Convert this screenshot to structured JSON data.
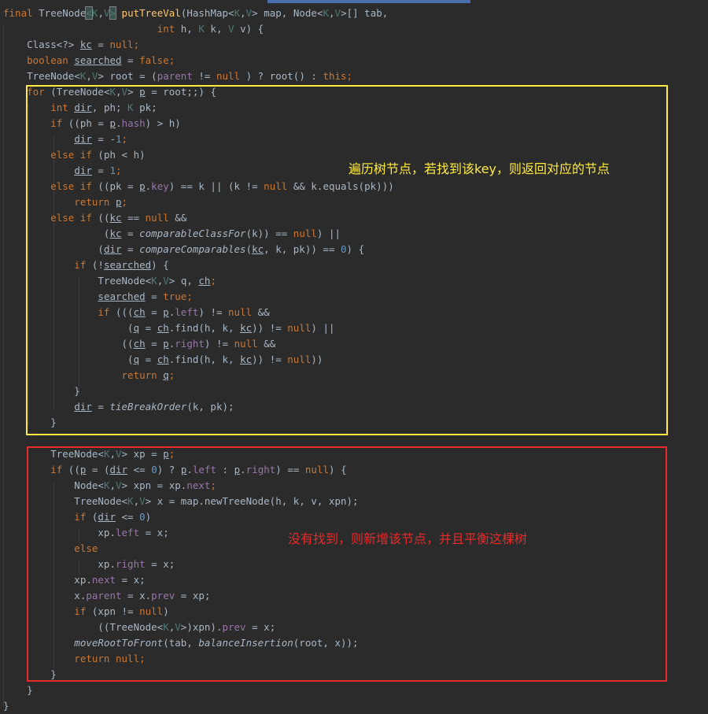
{
  "code_lines": [
    [
      [
        "kw",
        "final "
      ],
      [
        "",
        "TreeNode"
      ],
      [
        "tp brk",
        "<"
      ],
      [
        "tp",
        "K"
      ],
      [
        "",
        ","
      ],
      [
        "tp",
        "V"
      ],
      [
        "tp brk",
        ">"
      ],
      [
        "",
        ""
      ],
      [
        "fn",
        " putTreeVal"
      ],
      [
        "",
        "(HashMap<"
      ],
      [
        "tp",
        "K"
      ],
      [
        "",
        ","
      ],
      [
        "tp",
        "V"
      ],
      [
        "",
        "> map, Node<"
      ],
      [
        "tp",
        "K"
      ],
      [
        "",
        ","
      ],
      [
        "tp",
        "V"
      ],
      [
        "",
        ">[] tab,"
      ]
    ],
    [
      [
        "",
        "                          "
      ],
      [
        "kw",
        "int "
      ],
      [
        "",
        "h, "
      ],
      [
        "tp",
        "K "
      ],
      [
        "",
        "k, "
      ],
      [
        "tp",
        "V "
      ],
      [
        "",
        "v) {"
      ]
    ],
    [
      [
        "",
        "    Class<?> "
      ],
      [
        "ul",
        "kc"
      ],
      [
        "",
        " = "
      ],
      [
        "kw",
        "null"
      ],
      [
        "kw",
        ";"
      ]
    ],
    [
      [
        "kw",
        "    boolean "
      ],
      [
        "ul",
        "searched"
      ],
      [
        "",
        " = "
      ],
      [
        "kw",
        "false"
      ],
      [
        "kw",
        ";"
      ]
    ],
    [
      [
        "",
        "    TreeNode<"
      ],
      [
        "tp",
        "K"
      ],
      [
        "",
        ","
      ],
      [
        "tp",
        "V"
      ],
      [
        "",
        "> root = ("
      ],
      [
        "fld",
        "parent"
      ],
      [
        "",
        " != "
      ],
      [
        "kw",
        "null"
      ],
      [
        "",
        " ) ? root() : "
      ],
      [
        "kw",
        "this"
      ],
      [
        "kw",
        ";"
      ]
    ],
    [
      [
        "kw",
        "    for "
      ],
      [
        "",
        "(TreeNode<"
      ],
      [
        "tp",
        "K"
      ],
      [
        "",
        ","
      ],
      [
        "tp",
        "V"
      ],
      [
        "",
        "> "
      ],
      [
        "ul",
        "p"
      ],
      [
        "",
        " = root;;) {"
      ]
    ],
    [
      [
        "kw",
        "        int "
      ],
      [
        "ul",
        "dir"
      ],
      [
        "",
        ", ph; "
      ],
      [
        "tp",
        "K "
      ],
      [
        "",
        "pk;"
      ]
    ],
    [
      [
        "kw",
        "        if "
      ],
      [
        "",
        "(("
      ],
      [
        "",
        "ph = "
      ],
      [
        "ul",
        "p"
      ],
      [
        "",
        "."
      ],
      [
        "fld",
        "hash"
      ],
      [
        "",
        ") > h)"
      ]
    ],
    [
      [
        "",
        "            "
      ],
      [
        "ul",
        "dir"
      ],
      [
        "",
        " = -"
      ],
      [
        "num",
        "1"
      ],
      [
        "kw",
        ";"
      ]
    ],
    [
      [
        "kw",
        "        else if "
      ],
      [
        "",
        "(ph < h)"
      ]
    ],
    [
      [
        "",
        "            "
      ],
      [
        "ul",
        "dir"
      ],
      [
        "",
        " = "
      ],
      [
        "num",
        "1"
      ],
      [
        "kw",
        ";"
      ]
    ],
    [
      [
        "kw",
        "        else if "
      ],
      [
        "",
        "((pk = "
      ],
      [
        "ul",
        "p"
      ],
      [
        "",
        "."
      ],
      [
        "fld",
        "key"
      ],
      [
        "",
        ") == k || (k != "
      ],
      [
        "kw",
        "null "
      ],
      [
        "",
        "&& k.equals(pk)))"
      ]
    ],
    [
      [
        "kw",
        "            return "
      ],
      [
        "ul",
        "p"
      ],
      [
        "kw",
        ";"
      ]
    ],
    [
      [
        "kw",
        "        else if "
      ],
      [
        "",
        "(("
      ],
      [
        "ul",
        "kc"
      ],
      [
        "",
        " == "
      ],
      [
        "kw",
        "null "
      ],
      [
        "",
        "&&"
      ]
    ],
    [
      [
        "",
        "                 ("
      ],
      [
        "ul",
        "kc"
      ],
      [
        "",
        " = "
      ],
      [
        "it",
        "comparableClassFor"
      ],
      [
        "",
        "(k)) == "
      ],
      [
        "kw",
        "null"
      ],
      [
        "",
        ") ||"
      ]
    ],
    [
      [
        "",
        "                ("
      ],
      [
        "ul",
        "dir"
      ],
      [
        "",
        " = "
      ],
      [
        "it",
        "compareComparables"
      ],
      [
        "",
        "("
      ],
      [
        "ul",
        "kc"
      ],
      [
        "",
        ", k, pk)) == "
      ],
      [
        "num",
        "0"
      ],
      [
        "",
        ") {"
      ]
    ],
    [
      [
        "kw",
        "            if "
      ],
      [
        "",
        "(!"
      ],
      [
        "ul",
        "searched"
      ],
      [
        "",
        ") {"
      ]
    ],
    [
      [
        "",
        "                TreeNode<"
      ],
      [
        "tp",
        "K"
      ],
      [
        "",
        ","
      ],
      [
        "tp",
        "V"
      ],
      [
        "",
        "> "
      ],
      [
        "",
        "q, "
      ],
      [
        "ul",
        "ch"
      ],
      [
        "kw",
        ";"
      ]
    ],
    [
      [
        "",
        "                "
      ],
      [
        "ul",
        "searched"
      ],
      [
        "",
        " = "
      ],
      [
        "kw",
        "true"
      ],
      [
        "kw",
        ";"
      ]
    ],
    [
      [
        "kw",
        "                if "
      ],
      [
        "",
        "((("
      ],
      [
        "ul",
        "ch"
      ],
      [
        "",
        " = "
      ],
      [
        "ul",
        "p"
      ],
      [
        "",
        "."
      ],
      [
        "fld",
        "left"
      ],
      [
        "",
        ") != "
      ],
      [
        "kw",
        "null "
      ],
      [
        "",
        "&&"
      ]
    ],
    [
      [
        "",
        "                     ("
      ],
      [
        "ul",
        "q"
      ],
      [
        "",
        " = "
      ],
      [
        "ul",
        "ch"
      ],
      [
        "",
        ".find(h, k, "
      ],
      [
        "ul",
        "kc"
      ],
      [
        "",
        ")) != "
      ],
      [
        "kw",
        "null"
      ],
      [
        "",
        ") ||"
      ]
    ],
    [
      [
        "",
        "                    (("
      ],
      [
        "ul",
        "ch"
      ],
      [
        "",
        " = "
      ],
      [
        "ul",
        "p"
      ],
      [
        "",
        "."
      ],
      [
        "fld",
        "right"
      ],
      [
        "",
        ") != "
      ],
      [
        "kw",
        "null "
      ],
      [
        "",
        "&&"
      ]
    ],
    [
      [
        "",
        "                     ("
      ],
      [
        "ul",
        "q"
      ],
      [
        "",
        " = "
      ],
      [
        "ul",
        "ch"
      ],
      [
        "",
        ".find(h, k, "
      ],
      [
        "ul",
        "kc"
      ],
      [
        "",
        ")) != "
      ],
      [
        "kw",
        "null"
      ],
      [
        "",
        "))"
      ]
    ],
    [
      [
        "kw",
        "                    return "
      ],
      [
        "ul",
        "q"
      ],
      [
        "kw",
        ";"
      ]
    ],
    [
      [
        "",
        "            }"
      ]
    ],
    [
      [
        "",
        "            "
      ],
      [
        "ul",
        "dir"
      ],
      [
        "",
        " = "
      ],
      [
        "it",
        "tieBreakOrder"
      ],
      [
        "",
        "(k, pk);"
      ]
    ],
    [
      [
        "",
        "        }"
      ]
    ],
    [
      [
        "",
        ""
      ]
    ],
    [
      [
        "",
        "        TreeNode<"
      ],
      [
        "tp",
        "K"
      ],
      [
        "",
        ","
      ],
      [
        "tp",
        "V"
      ],
      [
        "",
        "> xp = "
      ],
      [
        "ul",
        "p"
      ],
      [
        "kw",
        ";"
      ]
    ],
    [
      [
        "kw",
        "        if "
      ],
      [
        "",
        "(("
      ],
      [
        "ul",
        "p"
      ],
      [
        "",
        " = ("
      ],
      [
        "ul",
        "dir"
      ],
      [
        "",
        " <= "
      ],
      [
        "num",
        "0"
      ],
      [
        "",
        ") ? "
      ],
      [
        "ul",
        "p"
      ],
      [
        "",
        "."
      ],
      [
        "fld",
        "left"
      ],
      [
        "",
        " : "
      ],
      [
        "ul",
        "p"
      ],
      [
        "",
        "."
      ],
      [
        "fld",
        "right"
      ],
      [
        "",
        ") == "
      ],
      [
        "kw",
        "null"
      ],
      [
        "",
        ") {"
      ]
    ],
    [
      [
        "",
        "            Node<"
      ],
      [
        "tp",
        "K"
      ],
      [
        "",
        ","
      ],
      [
        "tp",
        "V"
      ],
      [
        "",
        "> xpn = xp."
      ],
      [
        "fld",
        "next"
      ],
      [
        "kw",
        ";"
      ]
    ],
    [
      [
        "",
        "            TreeNode<"
      ],
      [
        "tp",
        "K"
      ],
      [
        "",
        ","
      ],
      [
        "tp",
        "V"
      ],
      [
        "",
        "> x = map.newTreeNode(h, k, v, xpn);"
      ]
    ],
    [
      [
        "kw",
        "            if "
      ],
      [
        "",
        "("
      ],
      [
        "ul",
        "dir"
      ],
      [
        "",
        " <= "
      ],
      [
        "num",
        "0"
      ],
      [
        "",
        ")"
      ]
    ],
    [
      [
        "",
        "                xp."
      ],
      [
        "fld",
        "left"
      ],
      [
        "",
        " = x;"
      ]
    ],
    [
      [
        "kw",
        "            else"
      ]
    ],
    [
      [
        "",
        "                xp."
      ],
      [
        "fld",
        "right"
      ],
      [
        "",
        " = x;"
      ]
    ],
    [
      [
        "",
        "            xp."
      ],
      [
        "fld",
        "next"
      ],
      [
        "",
        " = x;"
      ]
    ],
    [
      [
        "",
        "            x."
      ],
      [
        "fld",
        "parent"
      ],
      [
        "",
        " = x."
      ],
      [
        "fld",
        "prev"
      ],
      [
        "",
        " = xp;"
      ]
    ],
    [
      [
        "kw",
        "            if "
      ],
      [
        "",
        "(xpn != "
      ],
      [
        "kw",
        "null"
      ],
      [
        "",
        ")"
      ]
    ],
    [
      [
        "",
        "                ((TreeNode<"
      ],
      [
        "tp",
        "K"
      ],
      [
        "",
        ","
      ],
      [
        "tp",
        "V"
      ],
      [
        "",
        ">)xpn)."
      ],
      [
        "fld",
        "prev"
      ],
      [
        "",
        " = x;"
      ]
    ],
    [
      [
        "",
        "            "
      ],
      [
        "it",
        "moveRootToFront"
      ],
      [
        "",
        "(tab, "
      ],
      [
        "it",
        "balanceInsertion"
      ],
      [
        "",
        "(root, x));"
      ]
    ],
    [
      [
        "kw",
        "            return null"
      ],
      [
        "kw",
        ";"
      ]
    ],
    [
      [
        "",
        "        }"
      ]
    ],
    [
      [
        "",
        "    }"
      ]
    ],
    [
      [
        "",
        "}"
      ]
    ]
  ],
  "annotations": {
    "traverse": "遍历树节点，若找到该key，则返回对应的节点",
    "insert": "没有找到，则新增该节点，并且平衡这棵树"
  },
  "colors": {
    "background": "#2b2b2b",
    "keyword": "#cc7832",
    "method": "#ffc66d",
    "number": "#6897bb",
    "field": "#9876aa",
    "type_param": "#507874",
    "text": "#a9b7c6",
    "box_yellow": "#ffeb3b",
    "box_red": "#e52b2b",
    "annotation_yellow": "#ffeb3b",
    "annotation_red": "#e52b2b"
  }
}
